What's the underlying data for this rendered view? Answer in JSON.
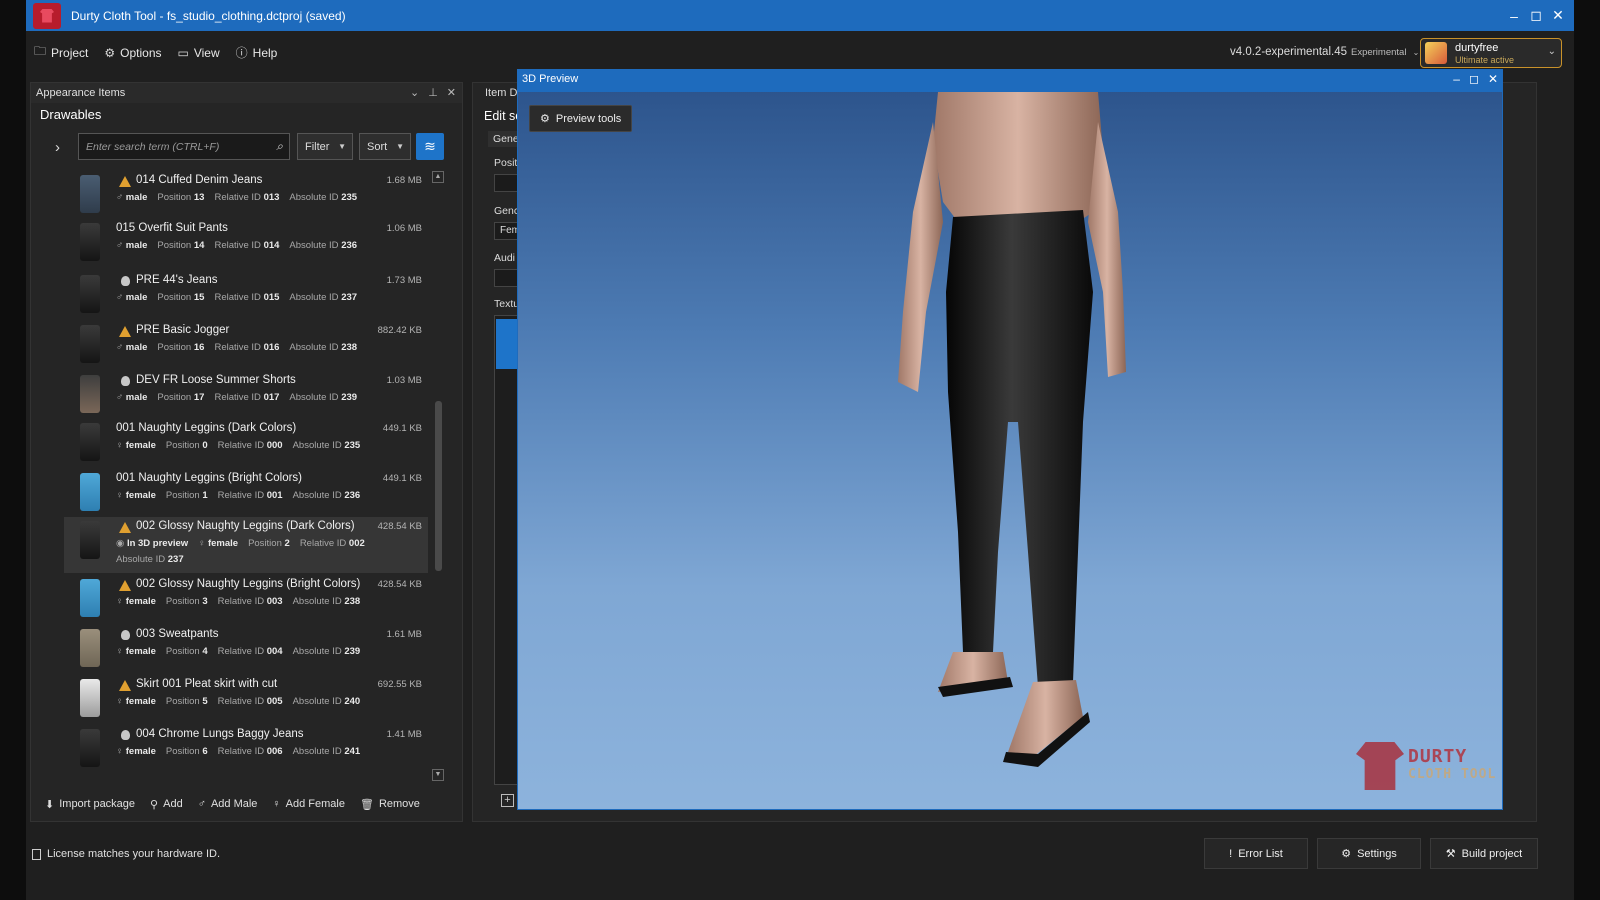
{
  "window": {
    "title": "Durty Cloth Tool - fs_studio_clothing.dctproj (saved)",
    "controls": [
      "–",
      "◻",
      "✕"
    ]
  },
  "menu": [
    {
      "label": "Project",
      "icon": "folder-icon"
    },
    {
      "label": "Options",
      "icon": "gear-icon"
    },
    {
      "label": "View",
      "icon": "window-icon"
    },
    {
      "label": "Help",
      "icon": "info-icon"
    }
  ],
  "version": {
    "label": "v4.0.2-experimental.45",
    "channel": "Experimental"
  },
  "user": {
    "name": "durtyfree",
    "status": "Ultimate active"
  },
  "appearance_panel": {
    "title": "Appearance Items",
    "section": "Drawables",
    "search_placeholder": "Enter search term (CTRL+F)",
    "filter_label": "Filter",
    "sort_label": "Sort"
  },
  "meta_labels": {
    "position": "Position",
    "relative": "Relative ID",
    "absolute": "Absolute ID",
    "preview": "In 3D preview"
  },
  "items": [
    {
      "title": "014 Cuffed Denim Jeans",
      "icon": "warning-icon",
      "size": "1.68 MB",
      "gender": "male",
      "position": "13",
      "relative": "013",
      "absolute": "235",
      "thumb": "denim"
    },
    {
      "title": "015 Overfit Suit Pants",
      "icon": "",
      "size": "1.06 MB",
      "gender": "male",
      "position": "14",
      "relative": "014",
      "absolute": "236",
      "thumb": "dark"
    },
    {
      "title": "PRE 44's Jeans",
      "icon": "bulb-icon",
      "size": "1.73 MB",
      "gender": "male",
      "position": "15",
      "relative": "015",
      "absolute": "237",
      "thumb": "dark"
    },
    {
      "title": "PRE Basic Jogger",
      "icon": "warning-icon",
      "size": "882.42 KB",
      "gender": "male",
      "position": "16",
      "relative": "016",
      "absolute": "238",
      "thumb": "dark"
    },
    {
      "title": "DEV FR Loose Summer Shorts",
      "icon": "bulb-icon",
      "size": "1.03 MB",
      "gender": "male",
      "position": "17",
      "relative": "017",
      "absolute": "239",
      "thumb": "shorts"
    },
    {
      "title": "001 Naughty Leggins (Dark Colors)",
      "icon": "",
      "size": "449.1 KB",
      "gender": "female",
      "position": "0",
      "relative": "000",
      "absolute": "235",
      "thumb": "dark"
    },
    {
      "title": "001 Naughty Leggins (Bright Colors)",
      "icon": "",
      "size": "449.1 KB",
      "gender": "female",
      "position": "1",
      "relative": "001",
      "absolute": "236",
      "thumb": "blue"
    },
    {
      "title": "002 Glossy Naughty Leggins (Dark Colors)",
      "icon": "warning-icon",
      "size": "428.54 KB",
      "gender": "female",
      "position": "2",
      "relative": "002",
      "absolute": "237",
      "thumb": "dark",
      "selected": true
    },
    {
      "title": "002 Glossy Naughty Leggins (Bright Colors)",
      "icon": "warning-icon",
      "size": "428.54 KB",
      "gender": "female",
      "position": "3",
      "relative": "003",
      "absolute": "238",
      "thumb": "blue"
    },
    {
      "title": "003 Sweatpants",
      "icon": "bulb-icon",
      "size": "1.61 MB",
      "gender": "female",
      "position": "4",
      "relative": "004",
      "absolute": "239",
      "thumb": "khaki"
    },
    {
      "title": "Skirt 001 Pleat skirt with cut",
      "icon": "warning-icon",
      "size": "692.55 KB",
      "gender": "female",
      "position": "5",
      "relative": "005",
      "absolute": "240",
      "thumb": "skirt"
    },
    {
      "title": "004 Chrome Lungs Baggy Jeans",
      "icon": "bulb-icon",
      "size": "1.41 MB",
      "gender": "female",
      "position": "6",
      "relative": "006",
      "absolute": "241",
      "thumb": "dark"
    }
  ],
  "footer_actions": [
    {
      "label": "Import package",
      "icon": "import-icon"
    },
    {
      "label": "Add",
      "icon": "add-icon"
    },
    {
      "label": "Add Male",
      "icon": "male-icon"
    },
    {
      "label": "Add Female",
      "icon": "female-icon"
    },
    {
      "label": "Remove",
      "icon": "trash-icon"
    }
  ],
  "details_panel": {
    "tab": "Item D",
    "edit_title": "Edit se",
    "subtab": "Gene",
    "labels": [
      "Positi",
      "Genc",
      "Audi",
      "Textu"
    ],
    "gender_value": "Fem"
  },
  "preview": {
    "title": "3D Preview",
    "tools_label": "Preview tools",
    "logo_line1": "DURTY",
    "logo_line2": "CLOTH TOOL"
  },
  "status": {
    "license": "License matches your hardware ID.",
    "error_list": "Error List",
    "settings": "Settings",
    "build": "Build project"
  },
  "colors": {
    "accent": "#1e6bbd",
    "warning": "#e0a030",
    "user_border": "#c9922a"
  }
}
